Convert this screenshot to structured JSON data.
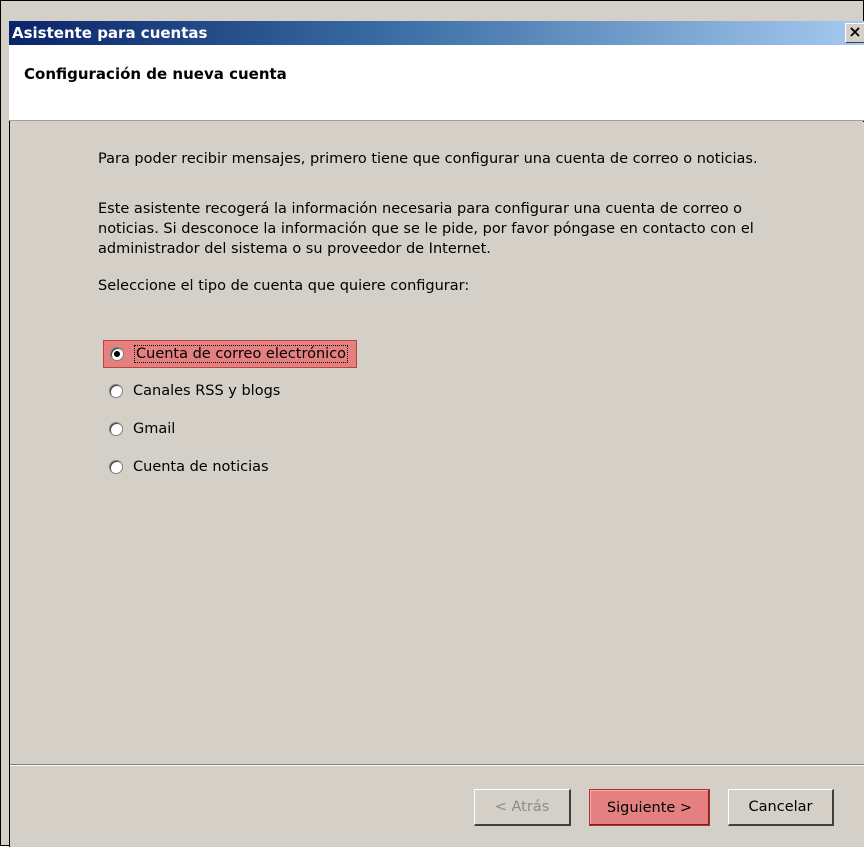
{
  "window": {
    "title": "Asistente para cuentas",
    "close_glyph": "×"
  },
  "header": {
    "title": "Configuración de nueva cuenta"
  },
  "body": {
    "intro": "Para poder recibir mensajes, primero tiene que configurar una cuenta de correo o noticias.",
    "description": "Este asistente recogerá la información necesaria para configurar una cuenta de correo o noticias. Si desconoce la información que se le pide, por favor póngase en contacto con el administrador del sistema o su proveedor de Internet.",
    "prompt": "Seleccione el tipo de cuenta que quiere configurar:"
  },
  "account_types": {
    "selected_index": 0,
    "options": [
      {
        "label": "Cuenta de correo electrónico"
      },
      {
        "label": "Canales RSS y blogs"
      },
      {
        "label": "Gmail"
      },
      {
        "label": "Cuenta de noticias"
      }
    ]
  },
  "buttons": {
    "back": "< Atrás",
    "next": "Siguiente >",
    "cancel": "Cancelar"
  },
  "colors": {
    "highlight": "#e58080",
    "titlebar_start": "#0a246a",
    "titlebar_end": "#a6caf0",
    "dialog_bg": "#d4d0c8"
  }
}
